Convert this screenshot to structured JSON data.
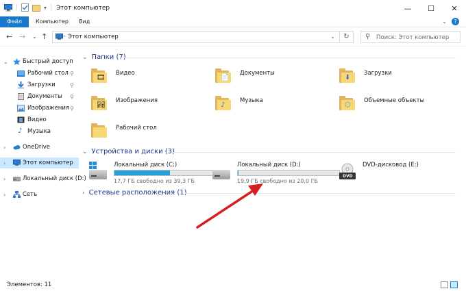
{
  "window": {
    "title": "Этот компьютер",
    "minimize": "—",
    "maximize": "☐",
    "close": "✕"
  },
  "ribbon": {
    "tabs": [
      "Файл",
      "Компьютер",
      "Вид"
    ],
    "expand": "⌄",
    "help": "?"
  },
  "nav": {
    "back": "←",
    "forward": "→",
    "recent": "⌄",
    "up": "↑",
    "address": "Этот компьютер",
    "address_sep": "›",
    "dropdown": "⌄",
    "refresh": "↻",
    "search_placeholder": "Поиск: Этот компьютер"
  },
  "sidebar": {
    "items": [
      {
        "label": "Быстрый доступ",
        "icon": "star-icon"
      },
      {
        "label": "Рабочий стол",
        "icon": "desktop-folder-icon"
      },
      {
        "label": "Загрузки",
        "icon": "download-icon"
      },
      {
        "label": "Документы",
        "icon": "documents-icon"
      },
      {
        "label": "Изображения",
        "icon": "pictures-icon"
      },
      {
        "label": "Видео",
        "icon": "video-icon"
      },
      {
        "label": "Музыка",
        "icon": "music-icon"
      },
      {
        "label": "OneDrive",
        "icon": "cloud-icon"
      },
      {
        "label": "Этот компьютер",
        "icon": "computer-icon"
      },
      {
        "label": "Локальный диск (D:)",
        "icon": "drive-icon"
      },
      {
        "label": "Сеть",
        "icon": "network-icon"
      }
    ],
    "pin": "📌",
    "expand": "›",
    "collapse": "⌄"
  },
  "groups": {
    "folders": "Папки (7)",
    "devices": "Устройства и диски (3)",
    "network": "Сетевые расположения (1)"
  },
  "folders": [
    {
      "label": "Видео",
      "emblem": "🎞"
    },
    {
      "label": "Документы",
      "emblem": "📄"
    },
    {
      "label": "Загрузки",
      "emblem": "⬇"
    },
    {
      "label": "Изображения",
      "emblem": "🏞"
    },
    {
      "label": "Музыка",
      "emblem": "♪"
    },
    {
      "label": "Объемные объекты",
      "emblem": "⬡"
    },
    {
      "label": "Рабочий стол",
      "emblem": ""
    }
  ],
  "drives": [
    {
      "label": "Локальный диск (C:)",
      "free": "17,7 ГБ свободно из 39,3 ГБ",
      "used_fraction": 0.55
    },
    {
      "label": "Локальный диск (D:)",
      "free": "19,9 ГБ свободно из 20,0 ГБ",
      "used_fraction": 0.005
    },
    {
      "label": "DVD-дисковод (E:)",
      "disc_label": "DVD"
    }
  ],
  "status": {
    "count": "Элементов: 11"
  },
  "colors": {
    "accent": "#1979ca",
    "selection": "#cce8ff",
    "group_header": "#1e3287",
    "progress_fill": "#26a0da",
    "arrow": "#d42020"
  }
}
